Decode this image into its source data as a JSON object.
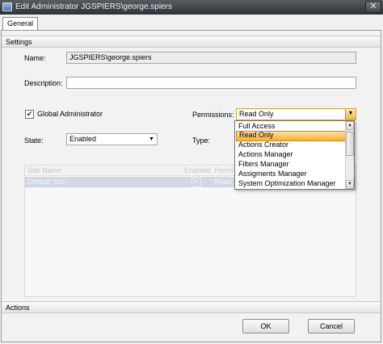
{
  "window": {
    "title": "Edit Administrator JGSPIERS\\george.spiers",
    "close_label": "✕",
    "icon": "app-monitor-icon"
  },
  "tabs": [
    {
      "label": "General"
    }
  ],
  "settings": {
    "header": "Settings",
    "name_label": "Name:",
    "name_value": "JGSPIERS\\george.spiers",
    "description_label": "Description:",
    "description_value": "",
    "global_admin_label": "Global Administrator",
    "global_admin_checked": true,
    "permissions_label": "Permissions:",
    "permissions_value": "Read Only",
    "state_label": "State:",
    "state_value": "Enabled",
    "type_label": "Type:"
  },
  "sites_grid": {
    "columns": [
      "Site Name",
      "Enabled",
      "Permi"
    ],
    "rows": [
      {
        "site_name": "Default Site",
        "enabled": true,
        "permission": "Read"
      }
    ]
  },
  "permissions_dropdown": {
    "options": [
      "Full Access",
      "Read Only",
      "Actions Creator",
      "Actions Manager",
      "Filters Manager",
      "Assigments Manager",
      "System Optimization Manager"
    ],
    "selected": "Read Only"
  },
  "actions": {
    "header": "Actions",
    "ok_label": "OK",
    "cancel_label": "Cancel"
  },
  "colors": {
    "selection": "#f3b03c",
    "titlebar": "#3a3d42",
    "grid_selection": "#cfd8e4"
  }
}
